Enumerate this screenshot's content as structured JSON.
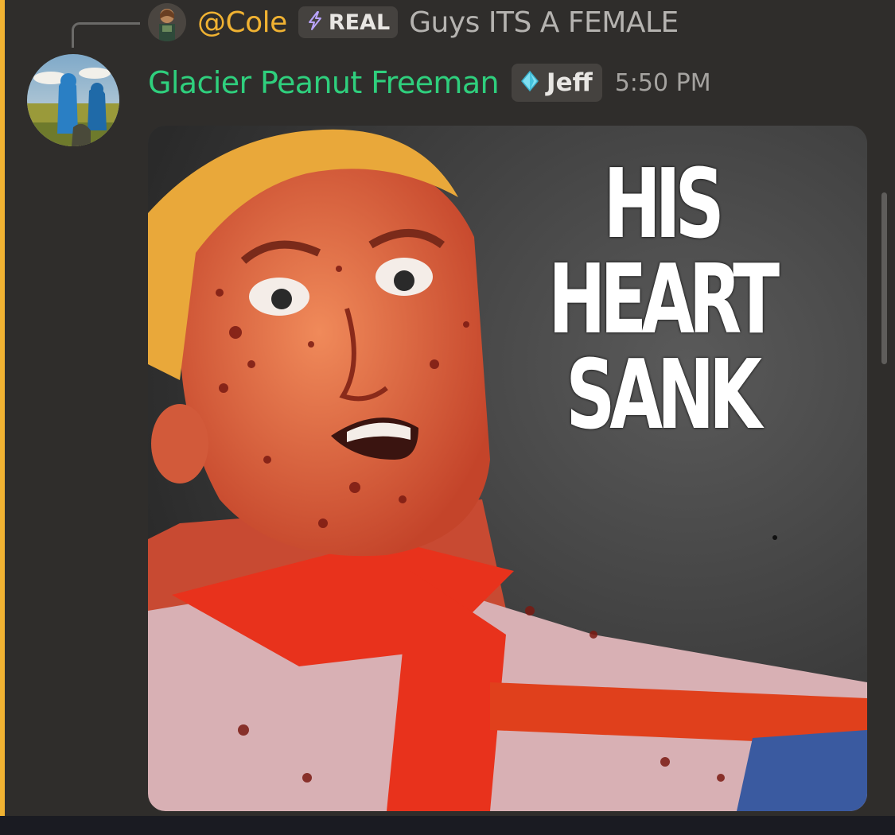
{
  "reply": {
    "username": "@Cole",
    "tag": "REAL",
    "tag_icon": "lightning-icon",
    "content": "Guys ITS A FEMALE"
  },
  "message": {
    "author": "Glacier Peanut Freeman",
    "clan_tag": "Jeff",
    "clan_icon": "water-drop-icon",
    "timestamp": "5:50 PM",
    "author_color": "#2fcf7d"
  },
  "attachment": {
    "type": "image",
    "caption_lines": [
      "HIS HEART",
      "SANK"
    ]
  },
  "colors": {
    "mention_accent": "#f0b232",
    "background": "#2f2d2b"
  }
}
